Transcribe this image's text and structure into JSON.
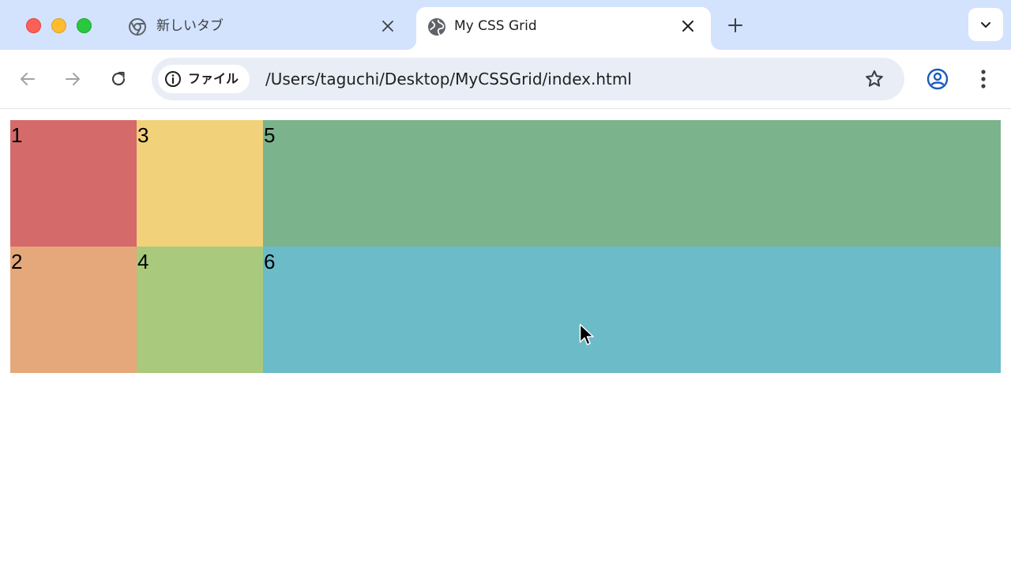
{
  "browser": {
    "tabs": [
      {
        "title": "新しいタブ",
        "active": false
      },
      {
        "title": "My CSS Grid",
        "active": true
      }
    ],
    "omnibox": {
      "chip_label": "ファイル",
      "url": "/Users/taguchi/Desktop/MyCSSGrid/index.html"
    },
    "accent_color": "#1a5bbf",
    "tabstrip_color": "#d3e3fd"
  },
  "page": {
    "grid_items": [
      {
        "label": "1",
        "color": "#d46a6a"
      },
      {
        "label": "2",
        "color": "#e5a87b"
      },
      {
        "label": "3",
        "color": "#f2d17b"
      },
      {
        "label": "4",
        "color": "#a9c97d"
      },
      {
        "label": "5",
        "color": "#7bb38c"
      },
      {
        "label": "6",
        "color": "#6bbcc8"
      }
    ]
  }
}
